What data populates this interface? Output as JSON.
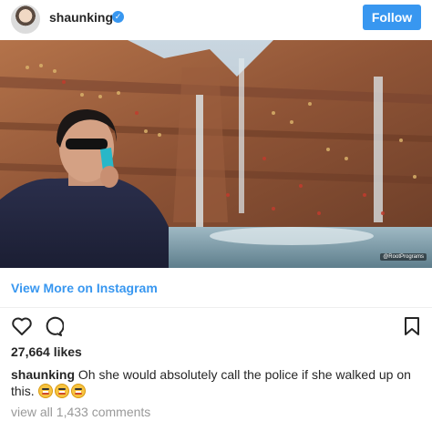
{
  "header": {
    "username": "shaunking",
    "verified_icon": "verified-badge-icon",
    "follow_label": "Follow",
    "accent_color": "#3897f0"
  },
  "photo": {
    "watermark": "@RootPrograms"
  },
  "view_more_label": "View More on Instagram",
  "actions": {
    "icons": [
      "heart-icon",
      "comment-icon",
      "bookmark-icon"
    ]
  },
  "likes": "27,664 likes",
  "caption": {
    "username": "shaunking",
    "text": "Oh she would absolutely call the police if she walked up on this.",
    "emoji_count": 3,
    "emoji_icon": "grimacing-face-icon"
  },
  "view_all_comments": "view all 1,433 comments"
}
